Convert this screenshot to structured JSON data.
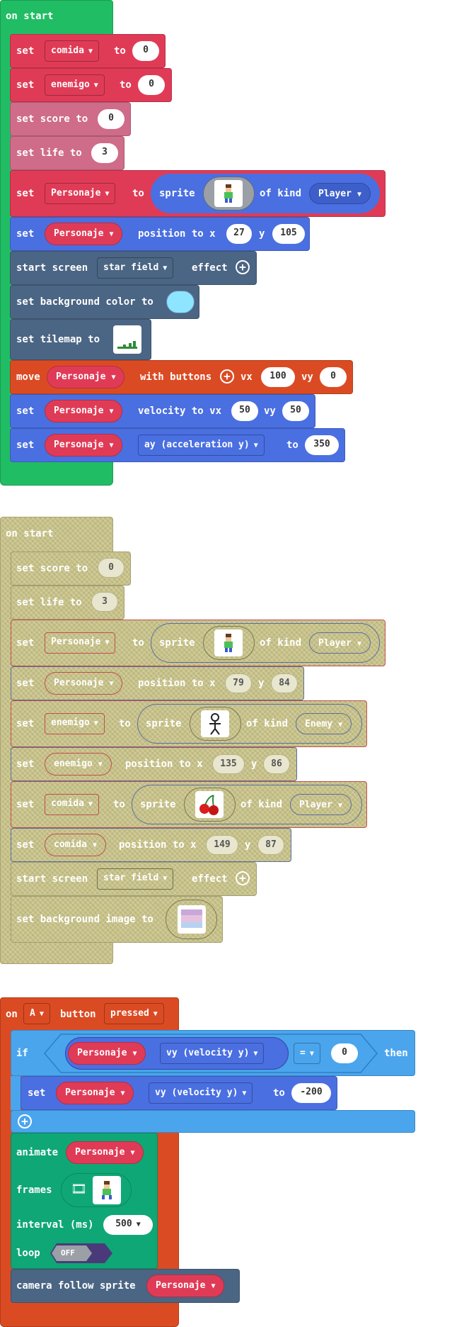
{
  "colors": {
    "green": "#21bd64",
    "red": "#e03b56",
    "blue": "#4a6fe1",
    "slate": "#4b6584",
    "orange": "#db4b23",
    "lightblue": "#4aa5ed",
    "teal": "#0fa775"
  },
  "block1": {
    "hat": "on start",
    "set_label": "set",
    "to_label": "to",
    "var_comida": "comida",
    "var_enemigo": "enemigo",
    "zero": "0",
    "score_label": "set score to",
    "score_val": "0",
    "life_label": "set life to",
    "life_val": "3",
    "personaje": "Personaje",
    "sprite_label": "sprite",
    "of_kind": "of kind",
    "kind_player": "Player",
    "position_to_x": "position to x",
    "y_label": "y",
    "pos_x": "27",
    "pos_y": "105",
    "start_screen": "start screen",
    "effect_sel": "star field",
    "effect_label": "effect",
    "bg_color_label": "set background color to",
    "bg_color": "#8de5ff",
    "tilemap_label": "set tilemap to",
    "move_label": "move",
    "with_buttons": "with buttons",
    "vx_label": "vx",
    "vy_label": "vy",
    "move_vx": "100",
    "move_vy": "0",
    "velocity_to_vx": "velocity to vx",
    "vel_vx": "50",
    "vel_vy": "50",
    "ay_sel": "ay (acceleration y)",
    "ay_val": "350"
  },
  "block2": {
    "hat": "on start",
    "score_label": "set score to",
    "score_val": "0",
    "life_label": "set life to",
    "life_val": "3",
    "set_label": "set",
    "to_label": "to",
    "personaje": "Personaje",
    "sprite_label": "sprite",
    "of_kind": "of kind",
    "kind_player": "Player",
    "kind_enemy": "Enemy",
    "position_to_x": "position to x",
    "y_label": "y",
    "p_x": "79",
    "p_y": "84",
    "enemigo": "enemigo",
    "e_x": "135",
    "e_y": "86",
    "comida": "comida",
    "c_x": "149",
    "c_y": "87",
    "start_screen": "start screen",
    "effect_sel": "star field",
    "effect_label": "effect",
    "bg_image_label": "set background image to"
  },
  "block3": {
    "on_label": "on",
    "button_sel": "A",
    "button_label": "button",
    "event_sel": "pressed",
    "if_label": "if",
    "personaje": "Personaje",
    "vy_sel": "vy (velocity y)",
    "op_sel": "=",
    "cmp_val": "0",
    "then_label": "then",
    "set_label": "set",
    "to_label": "to",
    "set_val": "-200",
    "animate_label": "animate",
    "frames_label": "frames",
    "interval_label": "interval (ms)",
    "interval_val": "500",
    "loop_label": "loop",
    "loop_state": "OFF",
    "camera_label": "camera follow sprite"
  }
}
